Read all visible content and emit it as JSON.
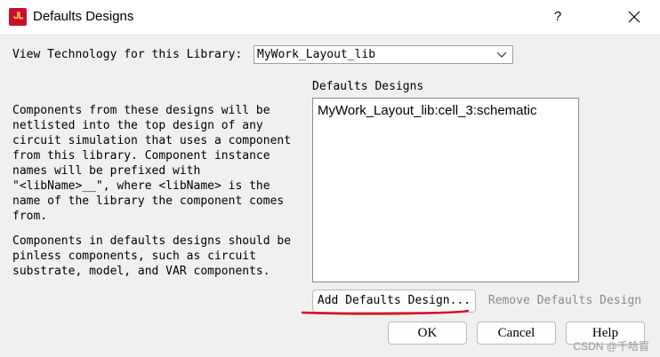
{
  "window": {
    "title": "Defaults Designs",
    "app_icon": "ads-logo-icon",
    "help_label": "?",
    "close_icon": "close-icon"
  },
  "technology": {
    "label": "View Technology for this Library:",
    "value": "MyWork_Layout_lib"
  },
  "description": {
    "para1": "Components from these designs will be\nnetlisted into the top design of any\ncircuit simulation that uses a component\nfrom this library. Component instance\nnames will be prefixed with\n\"<libName>__\", where <libName> is the\nname of the library the component comes\nfrom.",
    "para2": "Components in defaults designs should be\npinless components, such as circuit\nsubstrate, model, and VAR components."
  },
  "designs": {
    "label": "Defaults Designs",
    "items": [
      "MyWork_Layout_lib:cell_3:schematic"
    ]
  },
  "buttons": {
    "add": "Add Defaults Design...",
    "remove": "Remove Defaults Design",
    "ok": "OK",
    "cancel": "Cancel",
    "help": "Help"
  },
  "annotation_color": "#e0001b",
  "watermark": "CSDN @千哈冒"
}
